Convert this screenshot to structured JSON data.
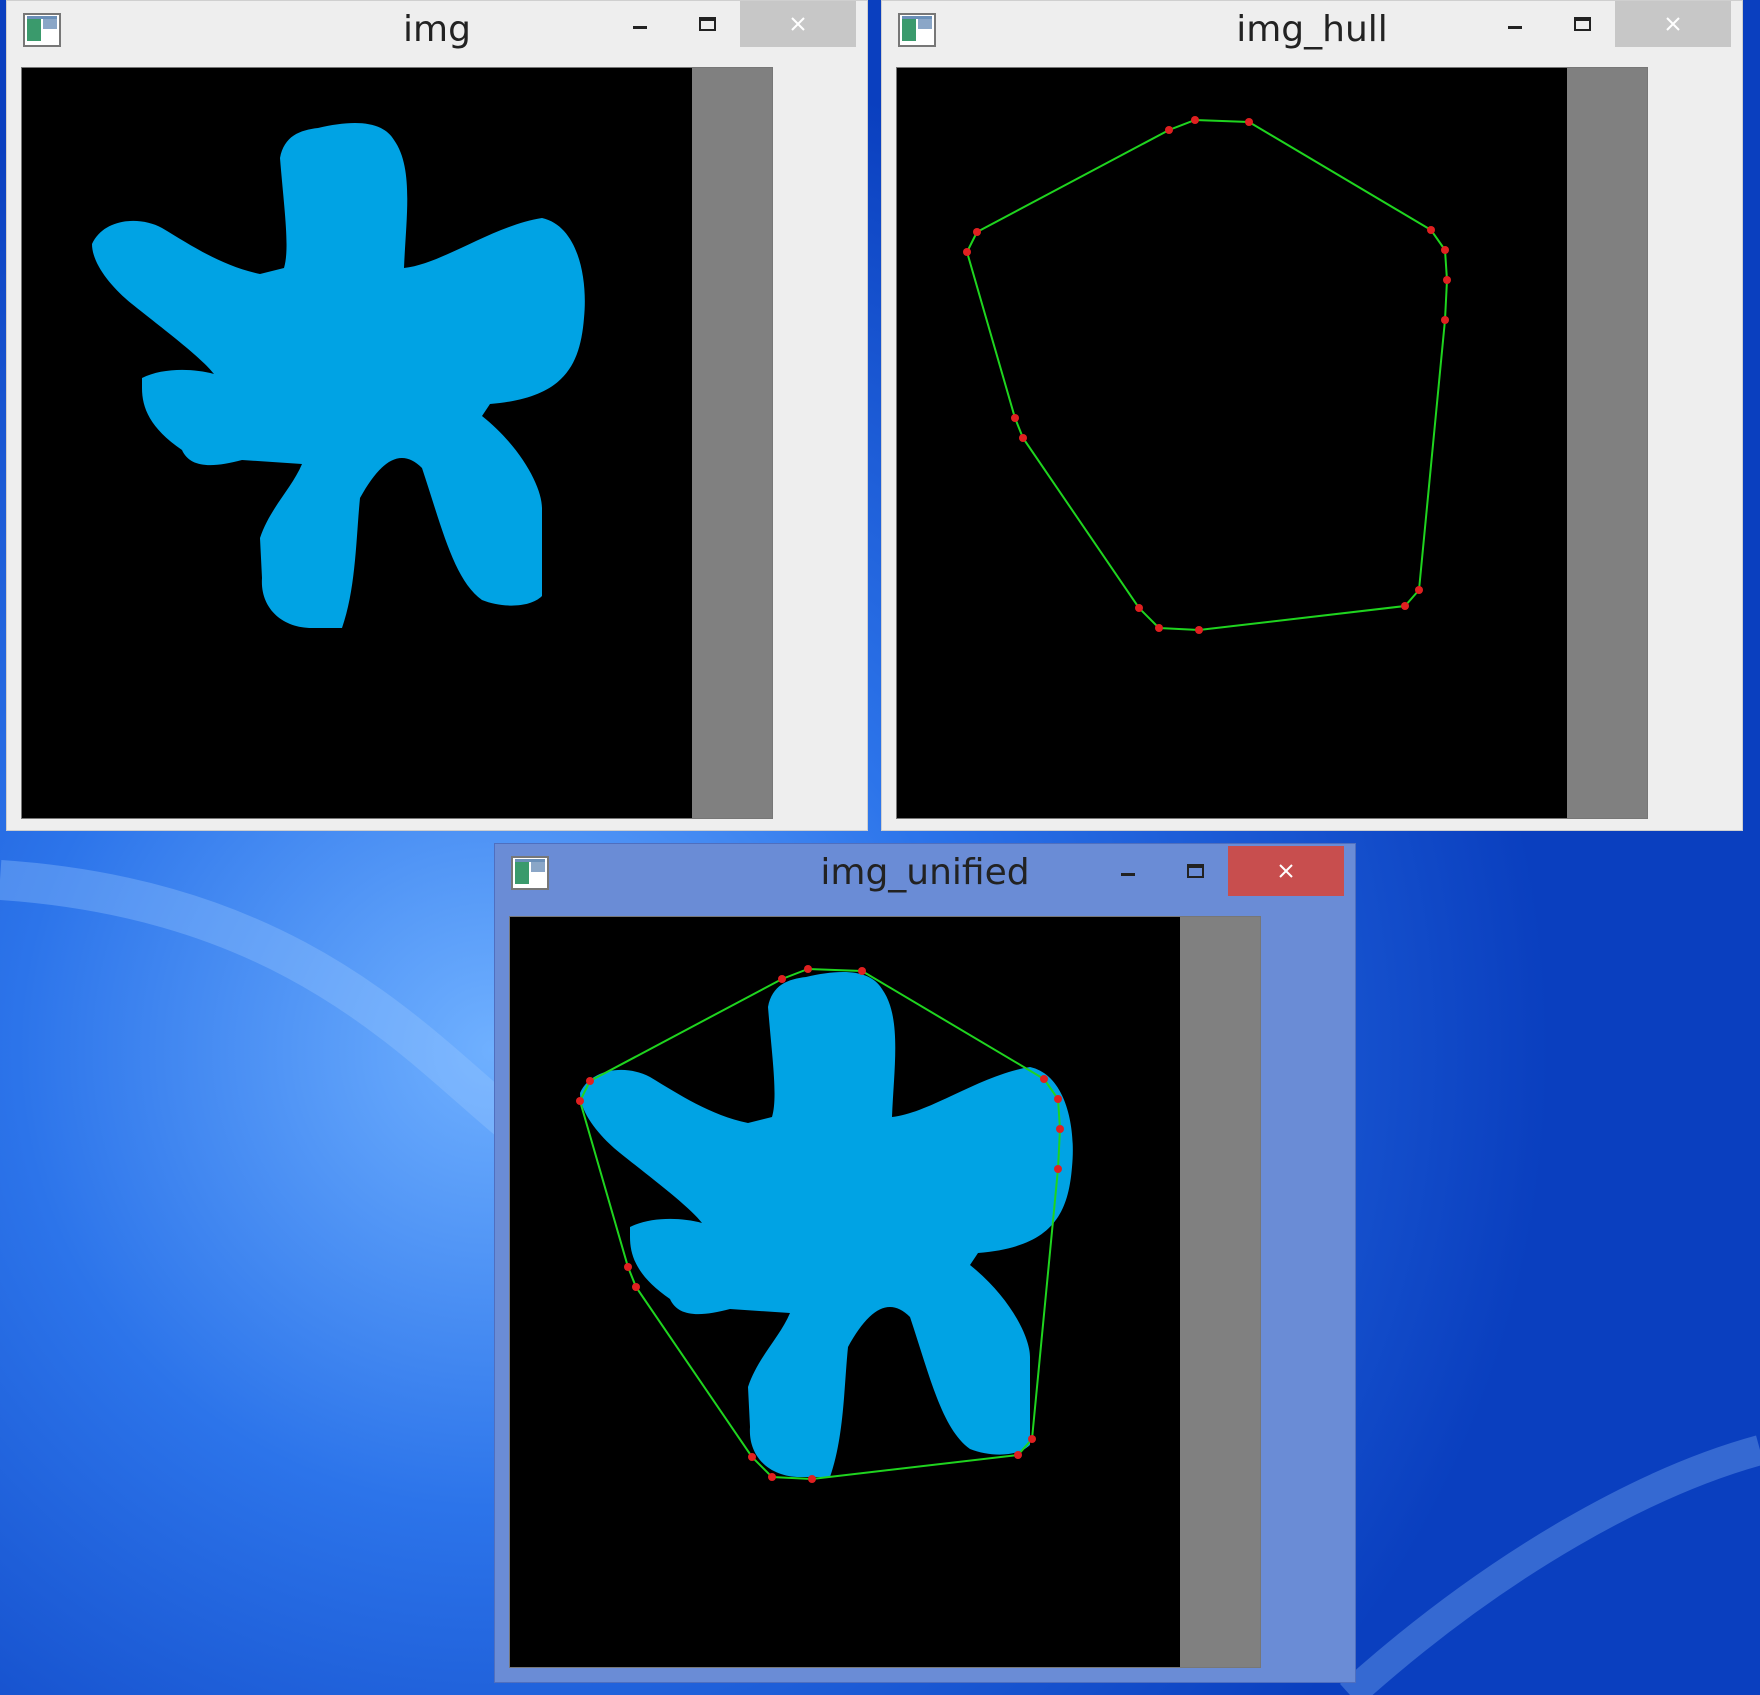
{
  "desktop": {
    "background_color": "#1456d8"
  },
  "windows": [
    {
      "title": "img",
      "icon": "app-window-icon",
      "state": "inactive",
      "shows_blob": true,
      "shows_hull": false
    },
    {
      "title": "img_hull",
      "icon": "app-window-icon",
      "state": "inactive",
      "shows_blob": false,
      "shows_hull": true
    },
    {
      "title": "img_unified",
      "icon": "app-window-icon",
      "state": "active",
      "shows_blob": true,
      "shows_hull": true
    }
  ],
  "controls": {
    "minimize": "minimize-icon",
    "maximize": "maximize-icon",
    "close": "close-icon"
  },
  "colors": {
    "blob": "#00a3e4",
    "hull_line": "#1fd41f",
    "hull_points": "#e02020",
    "canvas_bg": "#000000",
    "canvas_pad": "#808080"
  }
}
